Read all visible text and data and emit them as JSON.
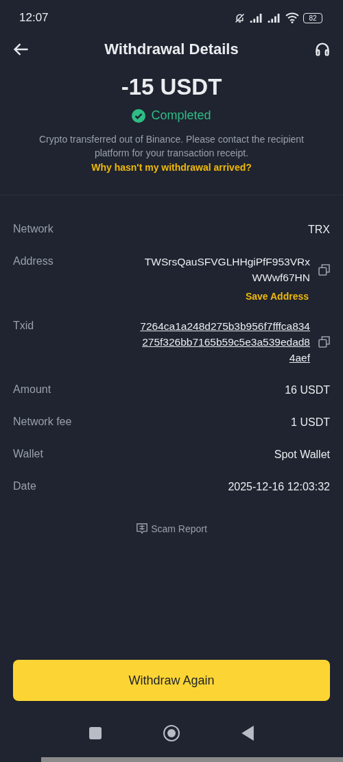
{
  "status_bar": {
    "time": "12:07",
    "battery": "82"
  },
  "header": {
    "title": "Withdrawal Details"
  },
  "summary": {
    "amount": "-15 USDT",
    "status": "Completed",
    "note": "Crypto transferred out of Binance. Please contact the recipient platform for your transaction receipt.",
    "help_link": "Why hasn't my withdrawal arrived?"
  },
  "details": [
    {
      "kind": "plain",
      "label": "Network",
      "value": "TRX"
    },
    {
      "kind": "address",
      "label": "Address",
      "value": "TWSrsQauSFVGLHHgiPfF953VRxWWwf67HN",
      "action": "Save Address"
    },
    {
      "kind": "txid",
      "label": "Txid",
      "value": "7264ca1a248d275b3b956f7fffca834275f326bb7165b59c5e3a539edad84aef"
    },
    {
      "kind": "plain",
      "label": "Amount",
      "value": "16 USDT"
    },
    {
      "kind": "plain",
      "label": "Network fee",
      "value": "1 USDT"
    },
    {
      "kind": "plain",
      "label": "Wallet",
      "value": "Spot Wallet"
    },
    {
      "kind": "plain",
      "label": "Date",
      "value": "2025-12-16 12:03:32"
    }
  ],
  "scam_report": "Scam Report",
  "primary_button": "Withdraw Again"
}
